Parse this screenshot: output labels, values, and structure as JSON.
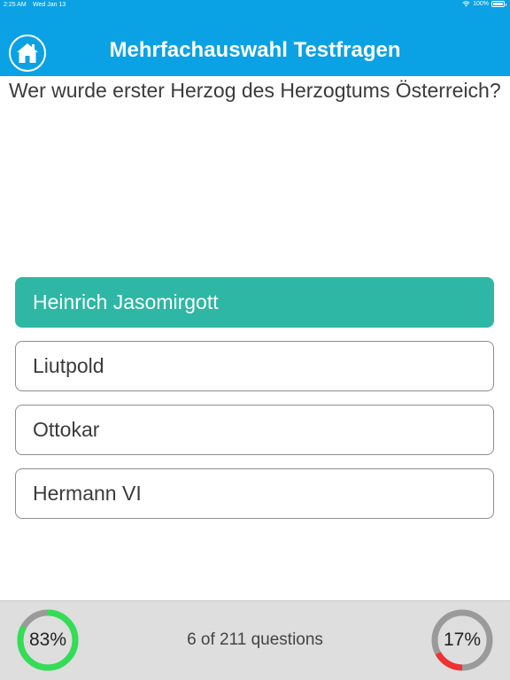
{
  "status_bar": {
    "time": "2:25 AM",
    "date": "Wed Jan 13",
    "battery": "100%"
  },
  "header": {
    "title": "Mehrfachauswahl Testfragen",
    "home_icon": "home-icon",
    "background_color": "#0aa2e4"
  },
  "question": {
    "text": "Wer wurde erster Herzog des Herzogtums Österreich?"
  },
  "answers": [
    {
      "label": "Heinrich Jasomirgott",
      "state": "correct"
    },
    {
      "label": "Liutpold",
      "state": "default"
    },
    {
      "label": "Ottokar",
      "state": "default"
    },
    {
      "label": "Hermann VI",
      "state": "default"
    }
  ],
  "footer": {
    "correct_percent_label": "83%",
    "correct_fraction": 0.83,
    "correct_color": "#33dd55",
    "counter_text": "6 of 211 questions",
    "wrong_percent_label": "17%",
    "wrong_fraction": 0.17,
    "wrong_color": "#ee3333",
    "ring_track_color": "#9a9a9a"
  }
}
